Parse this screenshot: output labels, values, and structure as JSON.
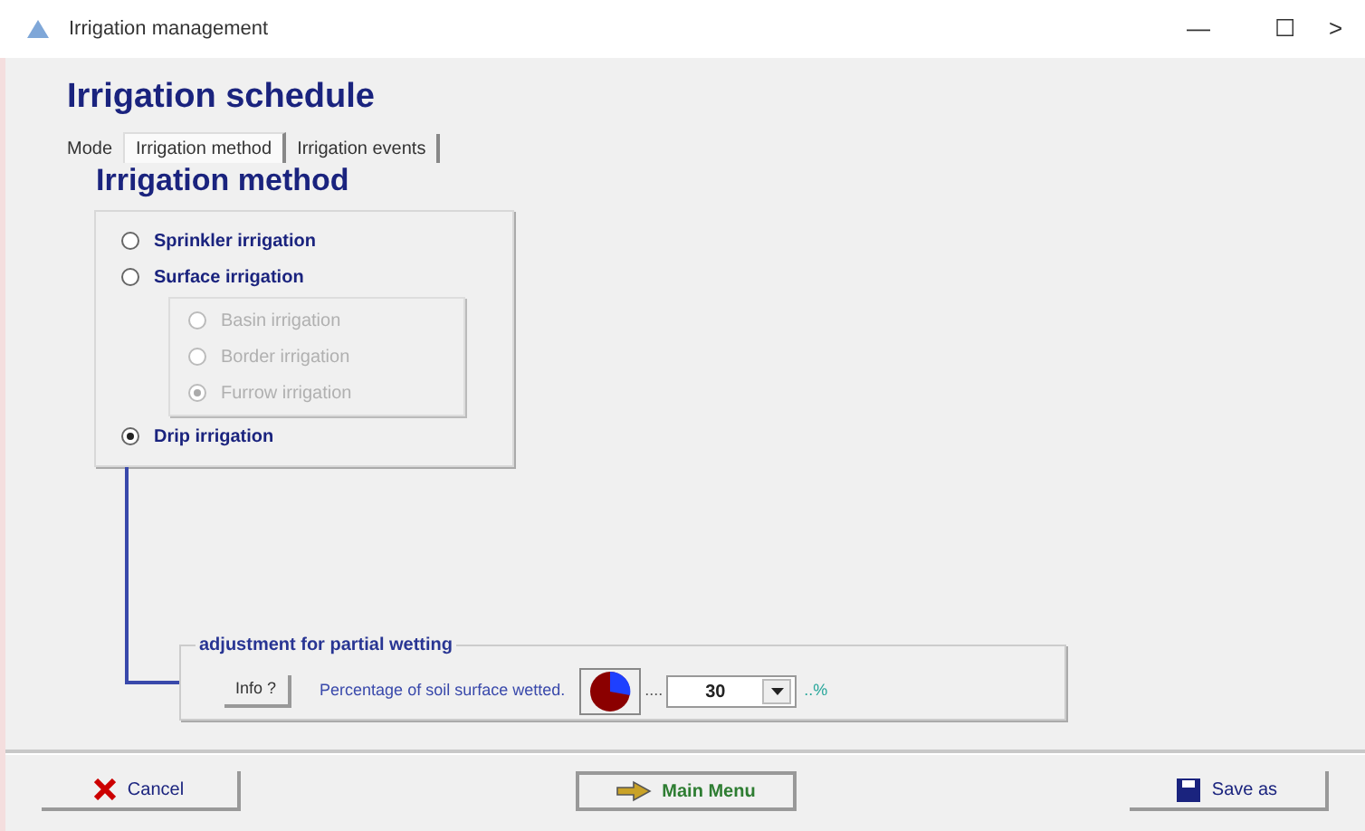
{
  "window": {
    "title": "Irrigation management",
    "controls": [
      "—",
      "☐",
      ">"
    ]
  },
  "heading": "Irrigation schedule",
  "tabs": [
    {
      "label": "Mode",
      "selected": false
    },
    {
      "label": "Irrigation method",
      "selected": true
    },
    {
      "label": "Irrigation events",
      "selected": false
    }
  ],
  "section_title": "Irrigation method",
  "methods": [
    {
      "label": "Sprinkler irrigation",
      "selected": false,
      "disabled": false
    },
    {
      "label": "Surface irrigation",
      "selected": false,
      "disabled": false,
      "children": [
        {
          "label": "Basin irrigation",
          "selected": false,
          "disabled": true
        },
        {
          "label": "Border irrigation",
          "selected": false,
          "disabled": true
        },
        {
          "label": "Furrow irrigation",
          "selected": true,
          "disabled": true
        }
      ]
    },
    {
      "label": "Drip irrigation",
      "selected": true,
      "disabled": false
    }
  ],
  "wetting": {
    "title": "adjustment for partial wetting",
    "info_button": "Info ?",
    "label": "Percentage of soil surface wetted.",
    "dots": "....",
    "value": "30",
    "unit": "..%"
  },
  "buttons": [
    {
      "kind": "cancel",
      "label": "Cancel"
    },
    {
      "kind": "menu",
      "label": "Main Menu"
    },
    {
      "kind": "save",
      "label": "Save as"
    }
  ]
}
